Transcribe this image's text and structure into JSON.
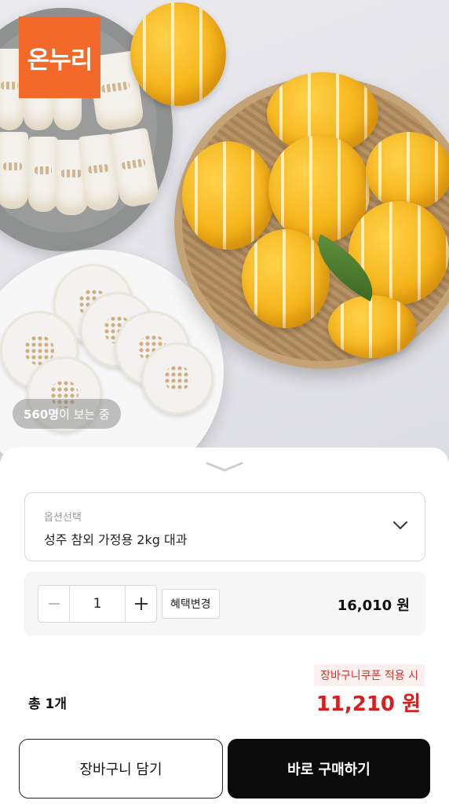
{
  "brand": {
    "logo_text": "온누리",
    "color": "#f2692a"
  },
  "viewers": {
    "count": "560명",
    "suffix": "이 보는 중"
  },
  "option": {
    "caption": "옵션선택",
    "selected": "성주 참외 가정용 2kg 대과",
    "icon": "chevron-down-icon"
  },
  "quantity": {
    "minus_icon": "minus-icon",
    "value": "1",
    "plus_icon": "plus-icon",
    "benefit_label": "혜택변경",
    "unit_price": "16,010 원"
  },
  "coupon": {
    "label": "장바구니쿠폰 적용 시",
    "color": "#d1342b"
  },
  "total": {
    "count_label": "총 1개",
    "price": "11,210 원",
    "price_color": "#d81f1f"
  },
  "actions": {
    "cart_label": "장바구니 담기",
    "buy_label": "바로 구매하기"
  }
}
